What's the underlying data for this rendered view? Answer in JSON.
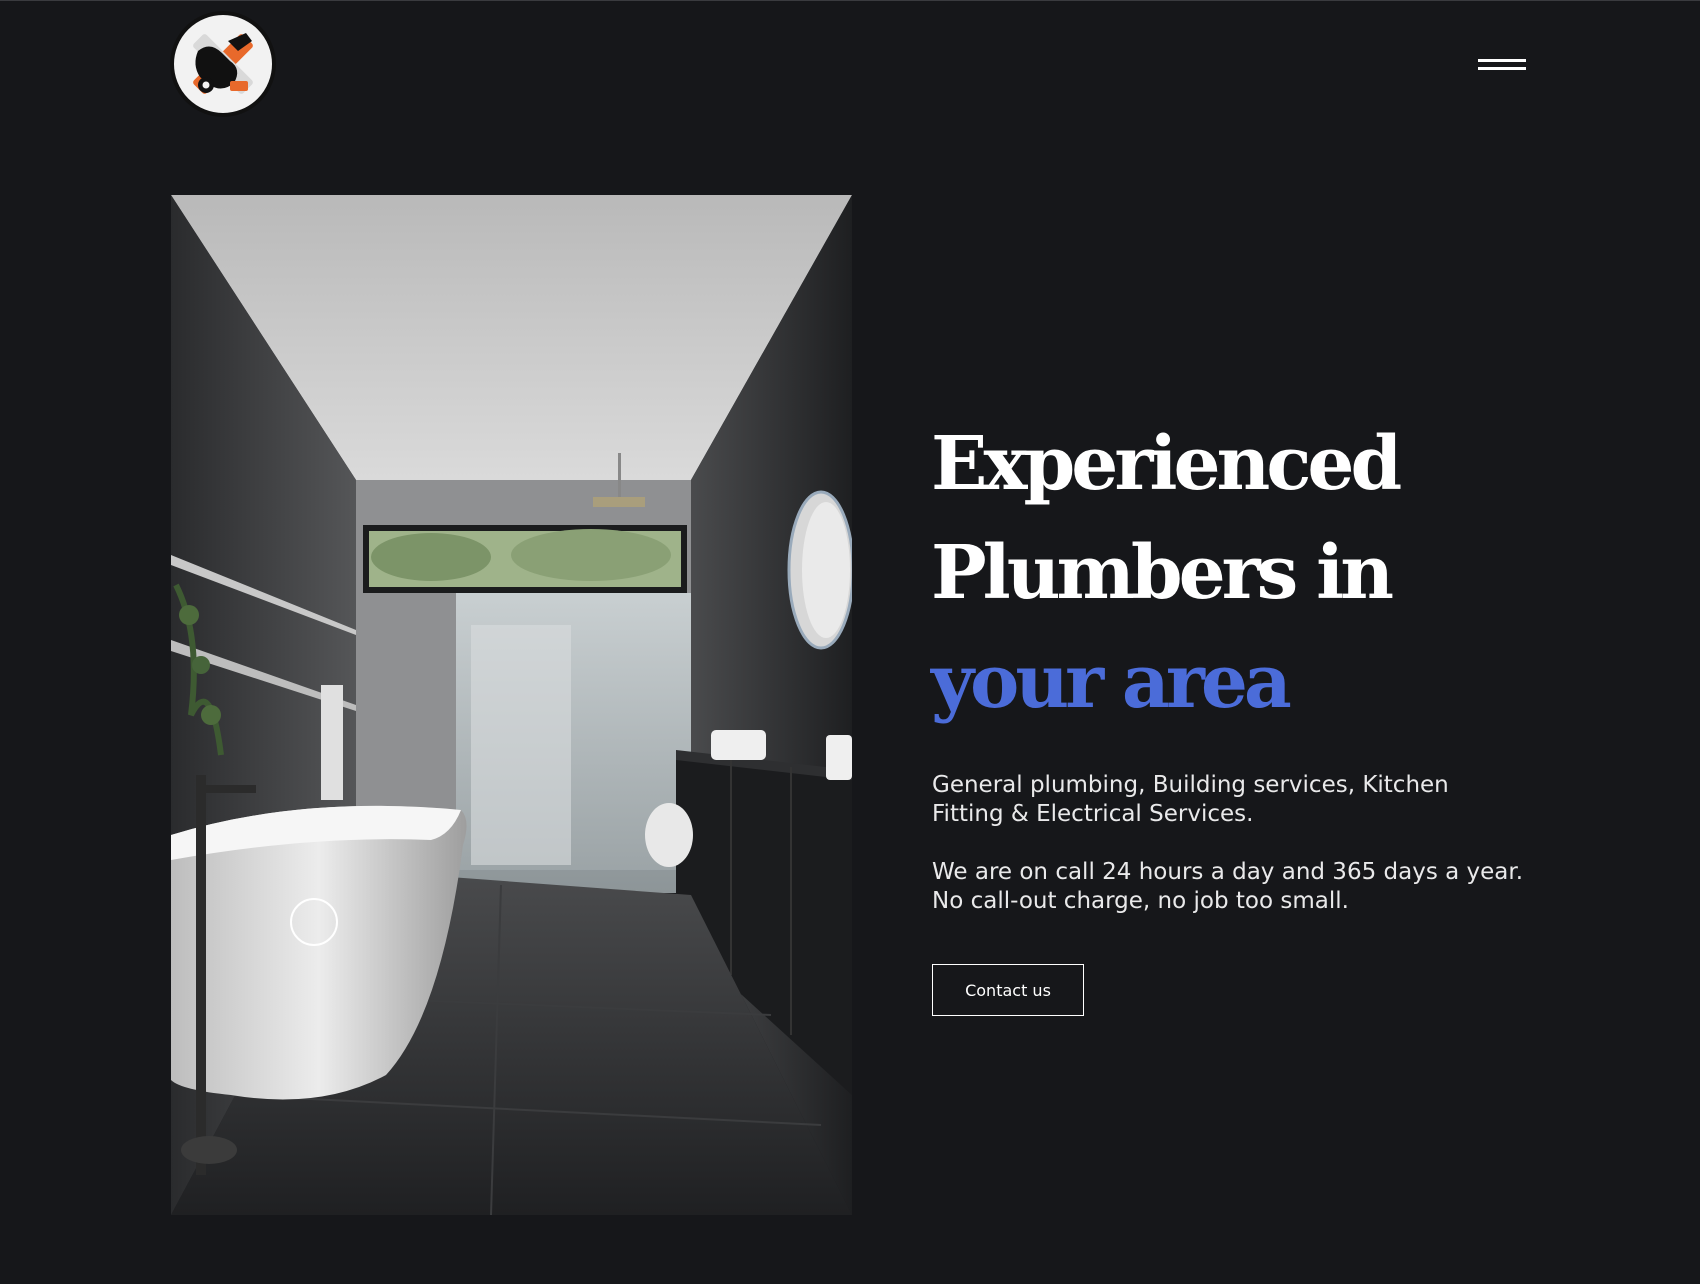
{
  "header": {
    "logo_alt": "Plumbing company logo",
    "menu_label": "Menu"
  },
  "hero": {
    "image_alt": "Modern dark bathroom with freestanding white bathtub, walk-in shower and black vanity",
    "headline": {
      "line1": "Experienced",
      "line2": "Plumbers in",
      "line3": "your area"
    },
    "description_1_line1": "General plumbing, Building services, Kitchen",
    "description_1_line2": "Fitting & Electrical Services.",
    "description_2_line1": "We are on call 24 hours a day and 365 days a year.",
    "description_2_line2": "No call-out charge, no job too small.",
    "cta_label": "Contact us"
  },
  "colors": {
    "background": "#16171a",
    "accent": "#4b6cd9",
    "text": "#ffffff",
    "logo_orange": "#e8692b"
  },
  "icons": {
    "menu": "hamburger-menu-icon",
    "logo": "wrench-pipe-logo-icon"
  }
}
